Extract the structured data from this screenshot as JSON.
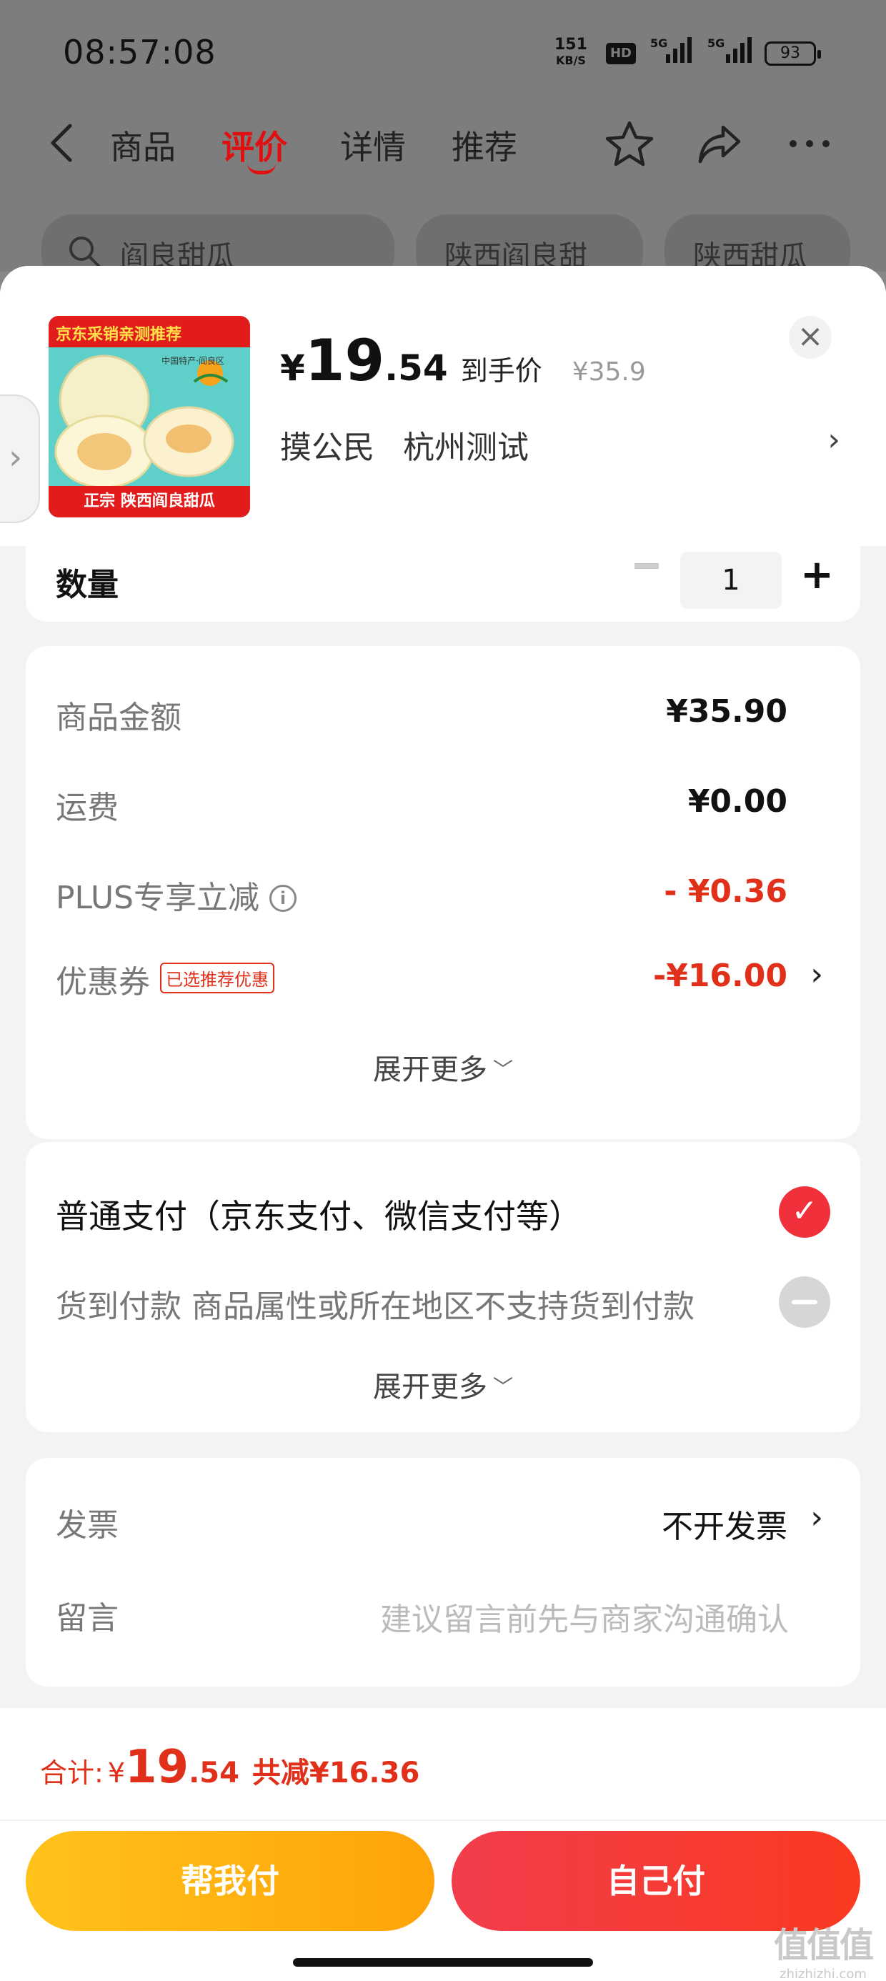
{
  "status_bar": {
    "time": "08:57:08",
    "net_speed_value": "151",
    "net_speed_unit": "KB/S",
    "hd": "HD",
    "signal1": "5G",
    "signal2": "5G",
    "battery": "93"
  },
  "nav": {
    "tabs": [
      {
        "label": "商品"
      },
      {
        "label": "评价",
        "active": true
      },
      {
        "label": "详情"
      },
      {
        "label": "推荐"
      }
    ]
  },
  "search_pills": [
    "阎良甜瓜",
    "陕西阎良甜",
    "陕西甜瓜"
  ],
  "product": {
    "image_banner": "京东采销亲测推荐",
    "image_brand": "中国特产·阎良区",
    "image_bottom": "正宗 陕西阎良甜瓜",
    "price_currency": "¥",
    "price_int": "19",
    "price_dec": ".54",
    "price_label": "到手价",
    "original_price": "¥35.9",
    "address_name": "摸公民",
    "address_city": "杭州测试",
    "close": "×"
  },
  "quantity": {
    "label": "数量",
    "value": "1",
    "plus": "+"
  },
  "amounts": {
    "goods_label": "商品金额",
    "goods_value": "¥35.90",
    "shipping_label": "运费",
    "shipping_value": "¥0.00",
    "plus_label": "PLUS专享立减",
    "plus_value": "- ¥0.36",
    "coupon_label": "优惠券",
    "coupon_tag": "已选推荐优惠",
    "coupon_value": "-¥16.00",
    "expand": "展开更多"
  },
  "payment": {
    "normal": "普通支付（京东支付、微信支付等）",
    "cod": "货到付款 商品属性或所在地区不支持货到付款",
    "expand": "展开更多"
  },
  "invoice": {
    "label": "发票",
    "value": "不开发票",
    "note_label": "留言",
    "note_placeholder": "建议留言前先与商家沟通确认"
  },
  "total": {
    "label": "合计:",
    "currency": "¥",
    "int": "19",
    "dec": ".54",
    "discount": "共减¥16.36"
  },
  "buttons": {
    "help_pay": "帮我付",
    "self_pay": "自己付"
  },
  "watermark": {
    "big": "值值值",
    "small": "zhizhizhi.com"
  },
  "colors": {
    "accent_red": "#e0301a",
    "help_button": "#ffb20f",
    "self_button": "#f53a36"
  }
}
